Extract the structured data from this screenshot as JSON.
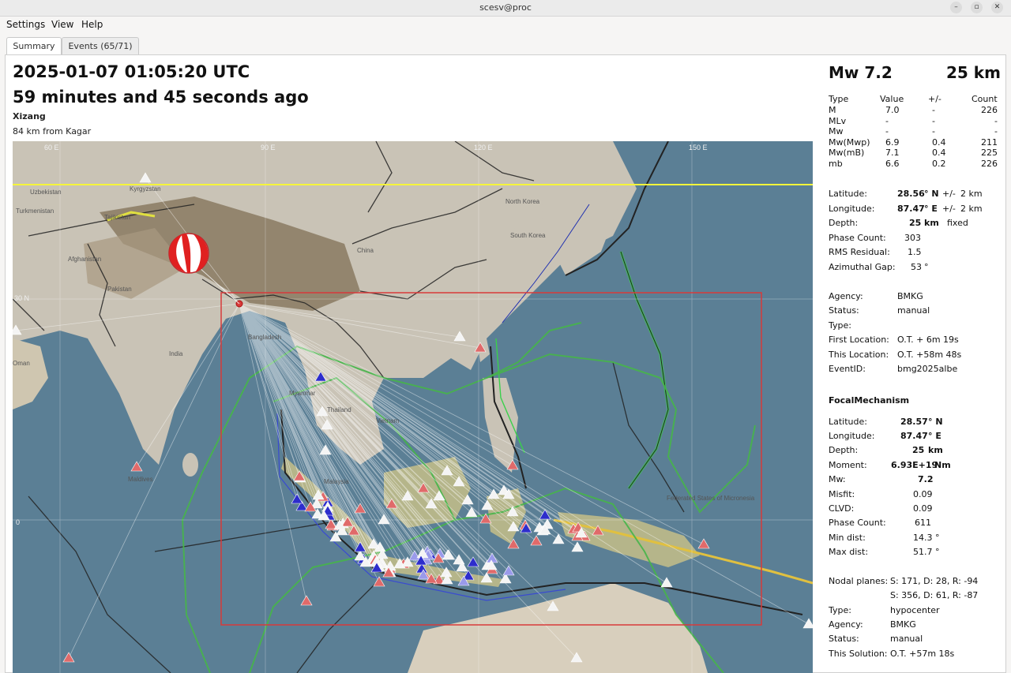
{
  "window": {
    "title": "scesv@proc",
    "minimize_glyph": "–",
    "maximize_glyph": "▫",
    "close_glyph": "✕"
  },
  "menu": [
    "Settings",
    "View",
    "Help"
  ],
  "tabs": [
    {
      "label": "Summary",
      "active": true
    },
    {
      "label": "Events (65/71)",
      "active": false
    }
  ],
  "summary": {
    "time": "2025-01-07 01:05:20 UTC",
    "ago": "59 minutes and 45 seconds ago",
    "region": "Xizang",
    "nearest": "84 km from Kagar"
  },
  "header": {
    "magnitude": "Mw 7.2",
    "depth": "25 km"
  },
  "magnitudes": {
    "columns": [
      "Type",
      "Value",
      "+/-",
      "Count"
    ],
    "rows": [
      [
        "M",
        "7.0",
        "-",
        "226"
      ],
      [
        "MLv",
        "-",
        "-",
        "-"
      ],
      [
        "Mw",
        "-",
        "-",
        "-"
      ],
      [
        "Mw(Mwp)",
        "6.9",
        "0.4",
        "211"
      ],
      [
        "Mw(mB)",
        "7.1",
        "0.4",
        "225"
      ],
      [
        "mb",
        "6.6",
        "0.2",
        "226"
      ]
    ]
  },
  "origin": {
    "latitude_label": "Latitude:",
    "latitude_value": "28.56",
    "latitude_unit": "° N",
    "latitude_pm": "+/-",
    "latitude_err": "2 km",
    "longitude_label": "Longitude:",
    "longitude_value": "87.47",
    "longitude_unit": "° E",
    "longitude_pm": "+/-",
    "longitude_err": "2 km",
    "depth_label": "Depth:",
    "depth_value": "25",
    "depth_unit": "km",
    "depth_note": "fixed",
    "phase_label": "Phase Count:",
    "phase_value": "303",
    "rms_label": "RMS Residual:",
    "rms_value": "1.5",
    "gap_label": "Azimuthal Gap:",
    "gap_value": "53",
    "gap_unit": "°"
  },
  "agency_block": [
    {
      "label": "Agency:",
      "value": "BMKG"
    },
    {
      "label": "Status:",
      "value": "manual"
    },
    {
      "label": "Type:",
      "value": ""
    },
    {
      "label": "First Location:",
      "value": "O.T. + 6m 19s"
    },
    {
      "label": "This Location:",
      "value": "O.T. +58m 48s"
    },
    {
      "label": "EventID:",
      "value": "bmg2025albe"
    }
  ],
  "focal": {
    "heading": "FocalMechanism",
    "latitude_label": "Latitude:",
    "latitude_value": "28.57",
    "latitude_unit": "° N",
    "longitude_label": "Longitude:",
    "longitude_value": "87.47",
    "longitude_unit": "° E",
    "depth_label": "Depth:",
    "depth_value": "25",
    "depth_unit": "km",
    "moment_label": "Moment:",
    "moment_value": "6.93E+19",
    "moment_unit": "Nm",
    "mw_label": "Mw:",
    "mw_value": "7.2",
    "misfit_label": "Misfit:",
    "misfit_value": "0.09",
    "clvd_label": "CLVD:",
    "clvd_value": "0.09",
    "phase_label": "Phase Count:",
    "phase_value": "611",
    "mindist_label": "Min dist:",
    "mindist_value": "14.3",
    "mindist_unit": "°",
    "maxdist_label": "Max dist:",
    "maxdist_value": "51.7",
    "maxdist_unit": "°",
    "nodal_label": "Nodal planes:",
    "nodal_1": "S: 171, D: 28, R: -94",
    "nodal_2": "S: 356, D: 61, R: -87",
    "type_label": "Type:",
    "type_value": "hypocenter",
    "agency_label": "Agency:",
    "agency_value": "BMKG",
    "status_label": "Status:",
    "status_value": "manual",
    "solution_label": "This Solution:",
    "solution_value": "O.T. +57m 18s"
  },
  "map": {
    "lon_labels": [
      "60 E",
      "90 E",
      "120 E",
      "150 E"
    ],
    "lat_labels": [
      "30 N",
      "0"
    ],
    "place_labels": [
      "Uzbekistan",
      "Kyrgyzstan",
      "Turkmenistan",
      "Tajikistan",
      "Afghanistan",
      "Pakistan",
      "India",
      "Oman",
      "China",
      "North Korea",
      "South Korea",
      "Bangladesh",
      "Myanmar",
      "Thailand",
      "Vietnam",
      "Malaysia",
      "Maldives",
      "Federated States of Micronesia"
    ],
    "colors": {
      "ocean": "#5b7f95",
      "land": "#c9c3b6",
      "plateau": "#8a7a62",
      "region_box": "#d83a3a",
      "yellow_line": "#f5f53a",
      "boundary": "#47b54a",
      "station_red": "#e06a6a",
      "station_blue": "#2d2dcc",
      "station_white": "#f4f4f4"
    },
    "epicenter_icon": "epicenter-icon",
    "beachball_icon": "beachball-icon"
  }
}
